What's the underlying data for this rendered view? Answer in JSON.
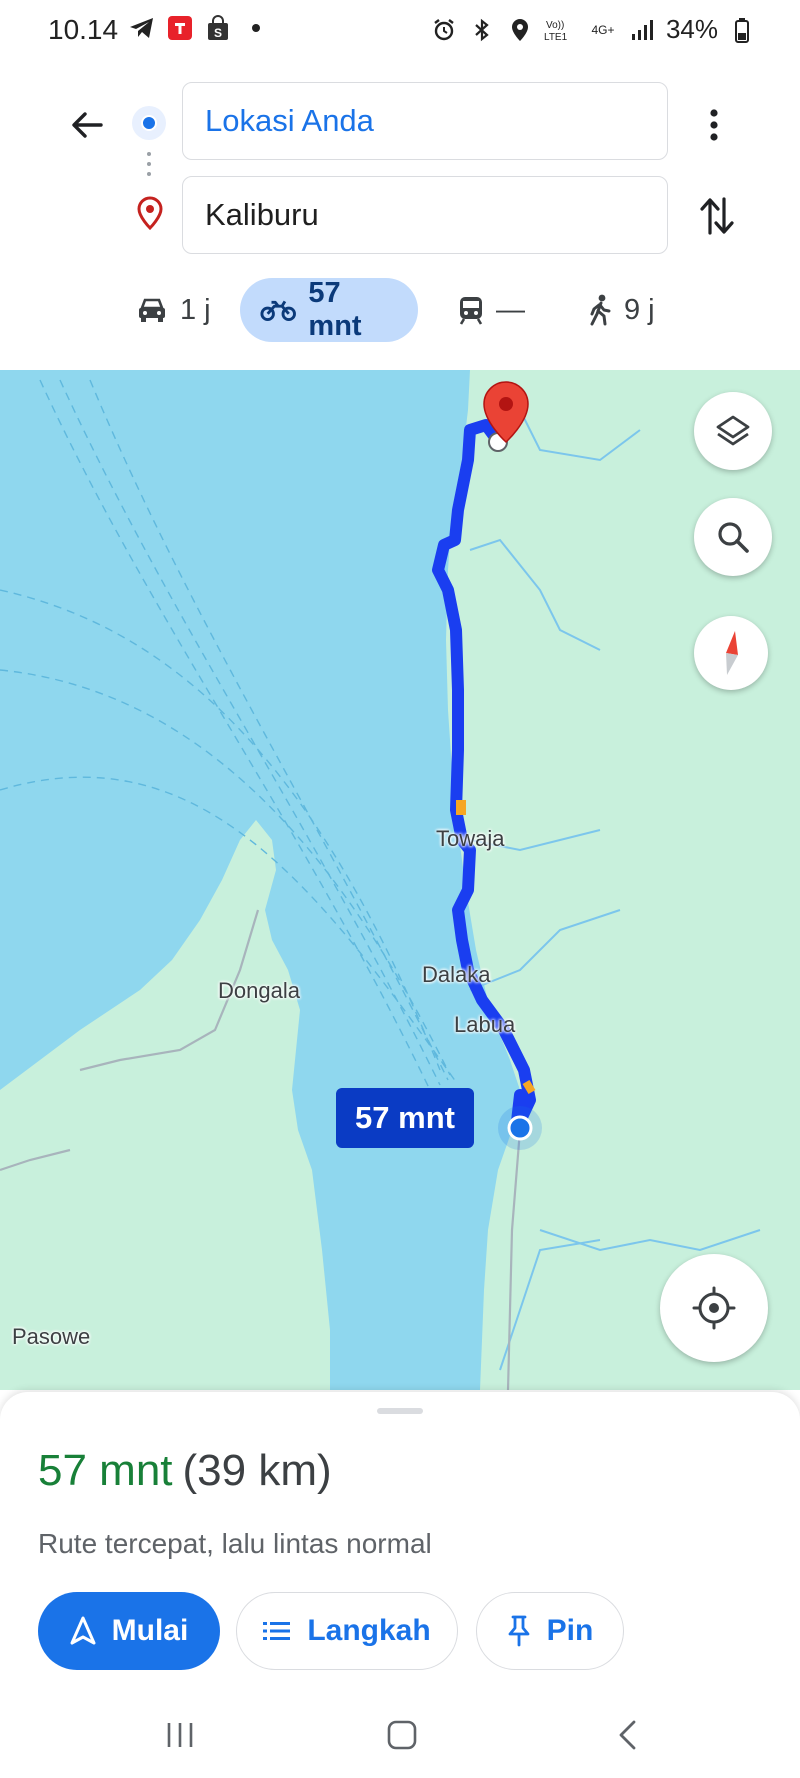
{
  "status_bar": {
    "time": "10.14",
    "battery": "34%",
    "network": "4G+",
    "notification_icons": [
      "telegram-icon",
      "tiket-app-icon",
      "shop-bag-icon",
      "dot-icon"
    ],
    "system_icons": [
      "alarm-icon",
      "bluetooth-icon",
      "location-icon",
      "volte-icon",
      "signal-icon",
      "battery-icon"
    ]
  },
  "header": {
    "origin": "Lokasi Anda",
    "destination": "Kaliburu"
  },
  "modes": [
    {
      "name": "car",
      "value": "1 j",
      "active": false
    },
    {
      "name": "motorcycle",
      "value": "57 mnt",
      "active": true
    },
    {
      "name": "transit",
      "value": "—",
      "active": false
    },
    {
      "name": "walk",
      "value": "9 j",
      "active": false
    }
  ],
  "map": {
    "labels": {
      "towaja": "Towaja",
      "dalaka": "Dalaka",
      "labua": "Labua",
      "dongala": "Dongala",
      "pasowe": "Pasowe"
    },
    "eta_bubble": "57 mnt",
    "colors": {
      "water": "#8fd7ee",
      "land": "#c8f0dc",
      "route": "#1a3ef0",
      "traffic": "#f6a623"
    }
  },
  "sheet": {
    "duration": "57 mnt",
    "distance": "(39 km)",
    "note": "Rute tercepat, lalu lintas normal",
    "start_label": "Mulai",
    "steps_label": "Langkah",
    "pin_label": "Pin"
  }
}
